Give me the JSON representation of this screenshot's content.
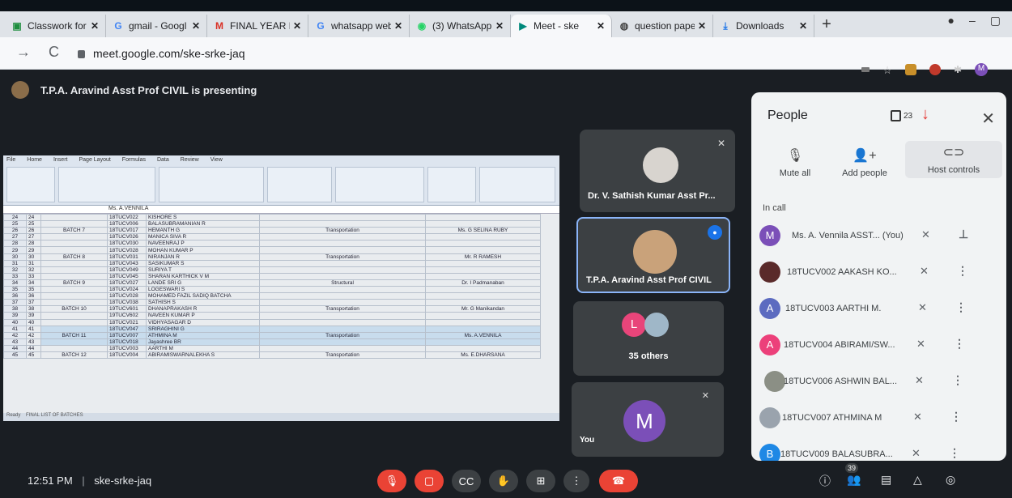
{
  "browser": {
    "tabs": [
      {
        "label": "Classwork for",
        "icon": "google-classroom-icon",
        "active": false
      },
      {
        "label": "gmail - Googl",
        "icon": "google-g-icon",
        "active": false
      },
      {
        "label": "FINAL YEAR PR",
        "icon": "gmail-m-icon",
        "active": false
      },
      {
        "label": "whatsapp web",
        "icon": "google-g-icon",
        "active": false
      },
      {
        "label": "(3) WhatsApp",
        "icon": "whatsapp-icon",
        "active": false
      },
      {
        "label": "Meet - ske",
        "icon": "meet-icon",
        "active": true
      },
      {
        "label": "question pape",
        "icon": "globe-icon",
        "active": false
      },
      {
        "label": "Downloads",
        "icon": "download-icon",
        "active": false
      }
    ],
    "url": "meet.google.com/ske-srke-jaq"
  },
  "meet": {
    "presenting_text": "T.P.A. Aravind Asst Prof CIVIL is presenting",
    "tiles": {
      "sathish": "Dr. V. Sathish Kumar Asst Pr...",
      "aravind": "T.P.A. Aravind Asst Prof CIVIL",
      "others": "35 others",
      "others_avatar": "L",
      "you": "You",
      "you_avatar": "M"
    },
    "people_panel": {
      "title": "People",
      "badge_count": "23",
      "mute_all": "Mute all",
      "add_people": "Add people",
      "host_controls": "Host controls",
      "in_call": "In call",
      "participants": [
        {
          "initial": "M",
          "name": "Ms. A. Vennila ASST... (You)",
          "color": "#7b4fb8"
        },
        {
          "initial": "",
          "name": "18TUCV002 AAKASH KO...",
          "color": "#5a2a2a"
        },
        {
          "initial": "A",
          "name": "18TUCV003 AARTHI M.",
          "color": "#5c6bc0"
        },
        {
          "initial": "A",
          "name": "18TUCV004 ABIRAMI/SW...",
          "color": "#ec407a"
        },
        {
          "initial": "",
          "name": "18TUCV006 ASHWIN BAL...",
          "color": "#8b8f85"
        },
        {
          "initial": "",
          "name": "18TUCV007 ATHMINA M",
          "color": "#9aa3ad"
        },
        {
          "initial": "B",
          "name": "18TUCV009 BALASUBRA...",
          "color": "#1e88e5"
        }
      ]
    },
    "bottom": {
      "time": "12:51 PM",
      "separator": "|",
      "meeting_code": "ske-srke-jaq",
      "participant_count": "39"
    }
  },
  "spreadsheet": {
    "name_box": "E",
    "formula": "Ms. A.VENNILA",
    "col_headers": [
      "A",
      "B",
      "C",
      "D",
      "E",
      "F"
    ],
    "rows": [
      {
        "rn": "24",
        "a": "24",
        "batch": "",
        "reg": "18TUCV022",
        "name": "KISHORE S",
        "subject": "",
        "guide": ""
      },
      {
        "rn": "25",
        "a": "25",
        "batch": "",
        "reg": "18TUCV006",
        "name": "BALASUBRAMANIAN R",
        "subject": "",
        "guide": ""
      },
      {
        "rn": "26",
        "a": "26",
        "batch": "BATCH 7",
        "reg": "18TUCV017",
        "name": "HEMANTH G",
        "subject": "Transportation",
        "guide": "Ms. G SELINA RUBY"
      },
      {
        "rn": "27",
        "a": "27",
        "batch": "",
        "reg": "18TUCV026",
        "name": "MANICA SIVA R",
        "subject": "",
        "guide": ""
      },
      {
        "rn": "28",
        "a": "28",
        "batch": "",
        "reg": "18TUCV030",
        "name": "NAVEENRAJ P",
        "subject": "",
        "guide": ""
      },
      {
        "rn": "29",
        "a": "29",
        "batch": "",
        "reg": "18TUCV028",
        "name": "MOHAN KUMAR P",
        "subject": "",
        "guide": ""
      },
      {
        "rn": "30",
        "a": "30",
        "batch": "BATCH 8",
        "reg": "18TUCV031",
        "name": "NIRANJAN R",
        "subject": "Transportation",
        "guide": "Mr. R RAMESH"
      },
      {
        "rn": "31",
        "a": "31",
        "batch": "",
        "reg": "18TUCV043",
        "name": "SASIKUMAR S",
        "subject": "",
        "guide": ""
      },
      {
        "rn": "32",
        "a": "32",
        "batch": "",
        "reg": "18TUCV049",
        "name": "SURIYA T",
        "subject": "",
        "guide": ""
      },
      {
        "rn": "33",
        "a": "33",
        "batch": "",
        "reg": "18TUCV045",
        "name": "SHARAN KARTHICK V M",
        "subject": "",
        "guide": ""
      },
      {
        "rn": "34",
        "a": "34",
        "batch": "BATCH 9",
        "reg": "18TUCV027",
        "name": "LANDE SRI G",
        "subject": "Structural",
        "guide": "Dr. I Padmanaban"
      },
      {
        "rn": "35",
        "a": "35",
        "batch": "",
        "reg": "18TUCV024",
        "name": "LOGESWARI S",
        "subject": "",
        "guide": ""
      },
      {
        "rn": "36",
        "a": "36",
        "batch": "",
        "reg": "18TUCV028",
        "name": "MOHAMED FAZIL SADIQ BATCHA",
        "subject": "",
        "guide": ""
      },
      {
        "rn": "37",
        "a": "37",
        "batch": "",
        "reg": "18TUCV038",
        "name": "SATHISH S",
        "subject": "",
        "guide": ""
      },
      {
        "rn": "38",
        "a": "38",
        "batch": "BATCH 10",
        "reg": "19TUCV601",
        "name": "DHANAPRAKASH R",
        "subject": "Transportation",
        "guide": "Mr. G Manikandan"
      },
      {
        "rn": "39",
        "a": "39",
        "batch": "",
        "reg": "19TUCV602",
        "name": "NAVEEN KUMAR P",
        "subject": "",
        "guide": ""
      },
      {
        "rn": "40",
        "a": "40",
        "batch": "",
        "reg": "18TUCV021",
        "name": "VIDHYASAGAR D",
        "subject": "",
        "guide": ""
      },
      {
        "rn": "41",
        "a": "41",
        "batch": "",
        "reg": "18TUCV047",
        "name": "SRIRAGHINI G",
        "subject": "",
        "guide": ""
      },
      {
        "rn": "42",
        "a": "42",
        "batch": "BATCH 11",
        "reg": "18TUCV007",
        "name": "ATHMINA M",
        "subject": "Transportation",
        "guide": "Ms. A.VENNILA"
      },
      {
        "rn": "43",
        "a": "43",
        "batch": "",
        "reg": "18TUCV018",
        "name": "Jayashree BR",
        "subject": "",
        "guide": ""
      },
      {
        "rn": "44",
        "a": "44",
        "batch": "",
        "reg": "18TUCV003",
        "name": "AARTHI M",
        "subject": "",
        "guide": ""
      },
      {
        "rn": "45",
        "a": "45",
        "batch": "BATCH 12",
        "reg": "18TUCV004",
        "name": "ABIRAMISWARNALEKHA S",
        "subject": "Transportation",
        "guide": "Ms. E.DHARSANA"
      }
    ],
    "status_left": "Ready",
    "status_sheet": "FINAL LIST OF BATCHES",
    "status_right": "Count: 113  100%"
  }
}
